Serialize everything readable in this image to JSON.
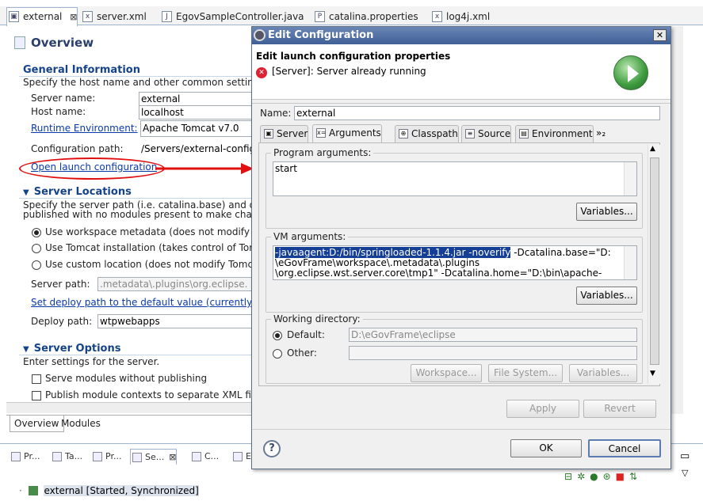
{
  "editor_tabs": [
    {
      "label": "external",
      "icon": "server-config-icon"
    },
    {
      "label": "server.xml",
      "icon": "xml-file-icon"
    },
    {
      "label": "EgovSampleController.java",
      "icon": "java-file-icon"
    },
    {
      "label": "catalina.properties",
      "icon": "properties-file-icon"
    },
    {
      "label": "log4j.xml",
      "icon": "xml-file-icon"
    }
  ],
  "overview": {
    "title": "Overview",
    "general": {
      "header": "General Information",
      "desc": "Specify the host name and other common settings.",
      "server_name_label": "Server name:",
      "server_name_value": "external",
      "host_name_label": "Host name:",
      "host_name_value": "localhost",
      "runtime_label": "Runtime Environment:",
      "runtime_value": "Apache Tomcat v7.0",
      "config_path_label": "Configuration path:",
      "config_path_value": "/Servers/external-config",
      "open_launch_link": "Open launch configuration"
    },
    "locations": {
      "header": "Server Locations",
      "desc1": "Specify the server path (i.e. catalina.base) and dep",
      "desc2": "published with no modules present to make chang",
      "radio1": "Use workspace metadata (does not modify To",
      "radio2": "Use Tomcat installation (takes control of Tom",
      "radio3": "Use custom location (does not modify Tomca",
      "server_path_label": "Server path:",
      "server_path_value": ".metadata\\.plugins\\org.eclipse.",
      "deploy_link": "Set deploy path to the default value (currently set",
      "deploy_path_label": "Deploy path:",
      "deploy_path_value": "wtpwebapps"
    },
    "options": {
      "header": "Server Options",
      "desc": "Enter settings for the server.",
      "check1": "Serve modules without publishing",
      "check2": "Publish module contexts to separate XML files"
    },
    "bottom_tabs": [
      "Overview",
      "Modules"
    ]
  },
  "views": {
    "tabs": [
      "Pr...",
      "Ta...",
      "Pr...",
      "Se...",
      "C...",
      "E"
    ],
    "server_entry": "external  [Started, Synchronized]"
  },
  "dialog": {
    "title": "Edit Configuration",
    "header_title": "Edit launch configuration properties",
    "header_message": "[Server]: Server already running",
    "name_label": "Name:",
    "name_value": "external",
    "tabs": [
      {
        "label": "Server"
      },
      {
        "label": "Arguments"
      },
      {
        "label": "Classpath"
      },
      {
        "label": "Source"
      },
      {
        "label": "Environment"
      },
      {
        "label": "»₂"
      }
    ],
    "program_args": {
      "group": "Program arguments:",
      "value": "start",
      "variables": "Variables..."
    },
    "vm_args": {
      "group": "VM arguments:",
      "line1_selected": "-javaagent:D:/bin/springloaded-1.1.4.jar -noverify",
      "line1_rest": " -Dcatalina.base=\"D:",
      "line2": "\\eGovFrame\\workspace\\.metadata\\.plugins",
      "line3": "\\org.eclipse.wst.server.core\\tmp1\" -Dcatalina.home=\"D:\\bin\\apache-",
      "variables": "Variables..."
    },
    "working_dir": {
      "group": "Working directory:",
      "default_label": "Default:",
      "default_value": "D:\\eGovFrame\\eclipse",
      "other_label": "Other:",
      "other_value": "",
      "workspace_btn": "Workspace...",
      "filesystem_btn": "File System...",
      "variables_btn": "Variables..."
    },
    "apply": "Apply",
    "revert": "Revert",
    "ok": "OK",
    "cancel": "Cancel",
    "help": "?",
    "close": "✕"
  }
}
